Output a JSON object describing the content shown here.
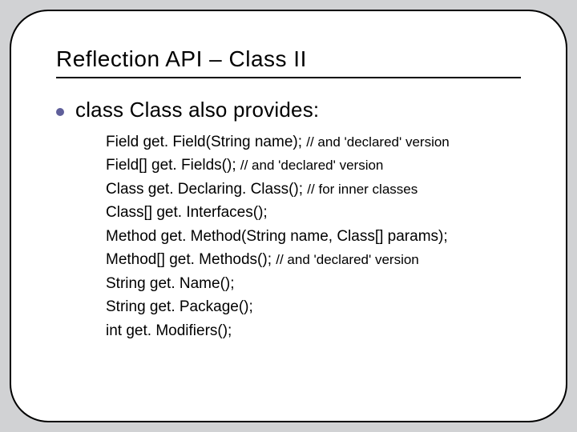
{
  "title": "Reflection API – Class II",
  "lead": "class Class also provides:",
  "lines": [
    {
      "code": "Field get. Field(String name); ",
      "comment": "// and 'declared' version"
    },
    {
      "code": "Field[] get. Fields(); ",
      "comment": "// and 'declared' version"
    },
    {
      "code": "Class get. Declaring. Class(); ",
      "comment": "// for inner classes"
    },
    {
      "code": "Class[] get. Interfaces();",
      "comment": ""
    },
    {
      "code": "Method get. Method(String name, Class[] params);",
      "comment": ""
    },
    {
      "code": "Method[] get. Methods(); ",
      "comment": "// and 'declared' version"
    },
    {
      "code": "String get. Name();",
      "comment": ""
    },
    {
      "code": "String get. Package();",
      "comment": ""
    },
    {
      "code": "int get. Modifiers();",
      "comment": ""
    }
  ]
}
